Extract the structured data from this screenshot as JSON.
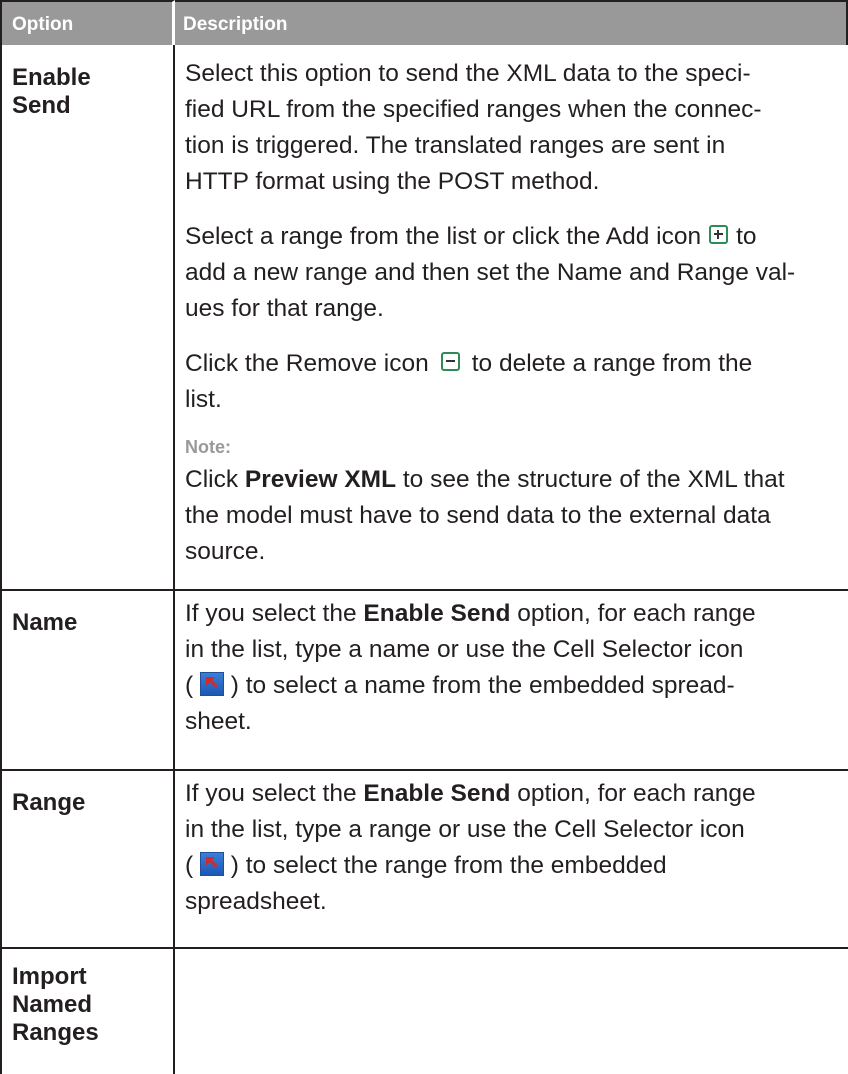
{
  "header": {
    "option": "Option",
    "description": "Description"
  },
  "rows": {
    "enable_send": {
      "option_line1": "Enable",
      "option_line2": "Send",
      "p1_l1": "Select this option to send the XML data to the speci-",
      "p1_l2": "fied URL from the specified ranges when the connec-",
      "p1_l3": "tion is triggered. The translated ranges are sent in",
      "p1_l4": "HTTP format using the POST method.",
      "p2_l1a": "Select a range from the list or click the Add icon",
      "p2_l1b": "to",
      "p2_l2": "add a new range and then set the Name and Range val-",
      "p2_l3": "ues for that range.",
      "p3_l1a": "Click the Remove icon",
      "p3_l1b": "to delete a range from the",
      "p3_l2": "list.",
      "note_label": "Note:",
      "note_l1a": "Click ",
      "note_l1b": "Preview XML",
      "note_l1c": " to see the structure of the XML that",
      "note_l2": "the model must have to send data to the external data",
      "note_l3": "source."
    },
    "name": {
      "option": "Name",
      "l1a": "If you select the ",
      "l1b": "Enable Send",
      "l1c": " option, for each range",
      "l2": "in the list, type a name or use the Cell Selector icon",
      "l3a": "( ",
      "l3b": " ) to select a name from the embedded spread-",
      "l4": "sheet."
    },
    "range": {
      "option": "Range",
      "l1a": "If you select the ",
      "l1b": "Enable Send",
      "l1c": " option, for each range",
      "l2": "in the list, type a range or use the Cell Selector icon",
      "l3a": "( ",
      "l3b": " ) to select the range from the embedded",
      "l4": "spreadsheet."
    },
    "import": {
      "option_line1": "Import",
      "option_line2": "Named",
      "option_line3": "Ranges"
    }
  }
}
